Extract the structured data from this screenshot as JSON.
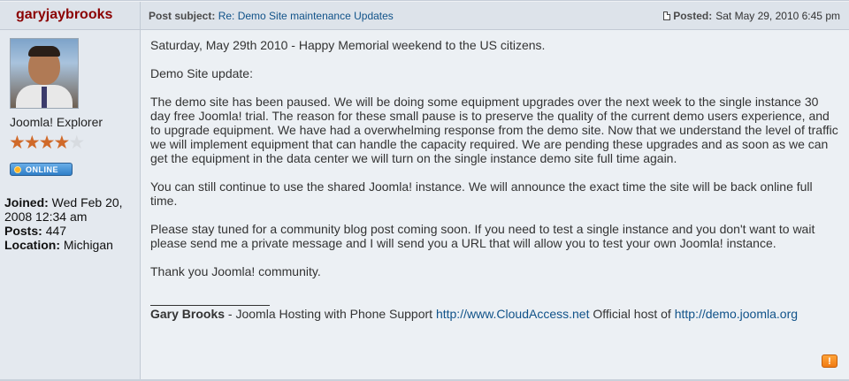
{
  "author": {
    "username": "garyjaybrooks",
    "rank": "Joomla! Explorer",
    "stars": {
      "filled": 4,
      "total": 5
    },
    "online_label": "ONLINE",
    "joined_label": "Joined:",
    "joined_value": "Wed Feb 20, 2008 12:34 am",
    "posts_label": "Posts:",
    "posts_value": "447",
    "location_label": "Location:",
    "location_value": "Michigan"
  },
  "header": {
    "subject_label": "Post subject:",
    "subject_value": "Re: Demo Site maintenance Updates",
    "posted_label": "Posted:",
    "posted_value": "Sat May 29, 2010 6:45 pm"
  },
  "body": {
    "paragraphs": [
      "Saturday, May 29th 2010 - Happy Memorial weekend to the US citizens.",
      "Demo Site update:",
      "The demo site has been paused. We will be doing some equipment upgrades over the next week to the single instance 30 day free Joomla! trial. The reason for these small pause is to preserve the quality of the current demo users experience, and to upgrade equipment. We have had a overwhelming response from the demo site. Now that we understand the level of traffic we will implement equipment that can handle the capacity required. We are pending these upgrades and as soon as we can get the equipment in the data center we will turn on the single instance demo site full time again.",
      "You can still continue to use the shared Joomla! instance. We will announce the exact time the site will be back online full time.",
      "Please stay tuned for a community blog post coming soon. If you need to test a single instance and you don't want to wait please send me a private message and I will send you a URL that will allow you to test your own Joomla! instance.",
      "Thank you Joomla! community."
    ]
  },
  "signature": {
    "name": "Gary Brooks",
    "text1": " - Joomla Hosting with Phone Support ",
    "link1": "http://www.CloudAccess.net",
    "text2": " Official host of ",
    "link2": "http://demo.joomla.org"
  },
  "actions": {
    "report_label": "!"
  },
  "colors": {
    "username": "#8b0000",
    "link": "#105289",
    "star": "#d06a2a",
    "online": "#2f7fc8",
    "report": "#f07a12"
  }
}
